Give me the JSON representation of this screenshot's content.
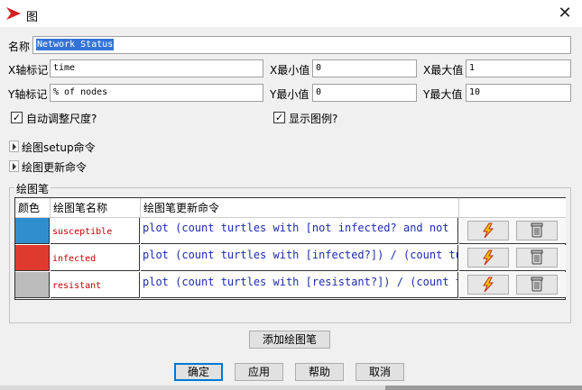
{
  "window": {
    "title": "图",
    "close_glyph": "✕",
    "app_icon": "red-arrow-icon"
  },
  "name": {
    "label": "名称",
    "value": "Network Status"
  },
  "x_axis": {
    "label": "X轴标记",
    "value": "time",
    "min_label": "X最小值",
    "min_value": "0",
    "max_label": "X最大值",
    "max_value": "1"
  },
  "y_axis": {
    "label": "Y轴标记",
    "value": "% of nodes",
    "min_label": "Y最小值",
    "min_value": "0",
    "max_label": "Y最大值",
    "max_value": "10"
  },
  "options": {
    "auto_scale_label": "自动调整尺度?",
    "auto_scale_checked": true,
    "show_legend_label": "显示图例?",
    "show_legend_checked": true
  },
  "sections": {
    "setup_label": "绘图setup命令",
    "update_label": "绘图更新命令"
  },
  "pens": {
    "group_title": "绘图笔",
    "columns": [
      "颜色",
      "绘图笔名称",
      "绘图笔更新命令"
    ],
    "rows": [
      {
        "color": "#2f8fce",
        "name": "susceptible",
        "command": "plot (count turtles with [not infected? and not re"
      },
      {
        "color": "#e03a2f",
        "name": "infected",
        "command": "plot (count turtles with [infected?]) / (count tur"
      },
      {
        "color": "#bcbcbc",
        "name": "resistant",
        "command": "plot (count turtles with [resistant?]) / (count tu"
      }
    ],
    "add_label": "添加绘图笔"
  },
  "footer": {
    "ok_label": "确定",
    "apply_label": "应用",
    "help_label": "帮助",
    "cancel_label": "取消"
  },
  "colors": {
    "accent": "#0078d7",
    "selection": "#3574d6",
    "pen_name": "#c00000",
    "command_text": "#1e2bb0"
  }
}
